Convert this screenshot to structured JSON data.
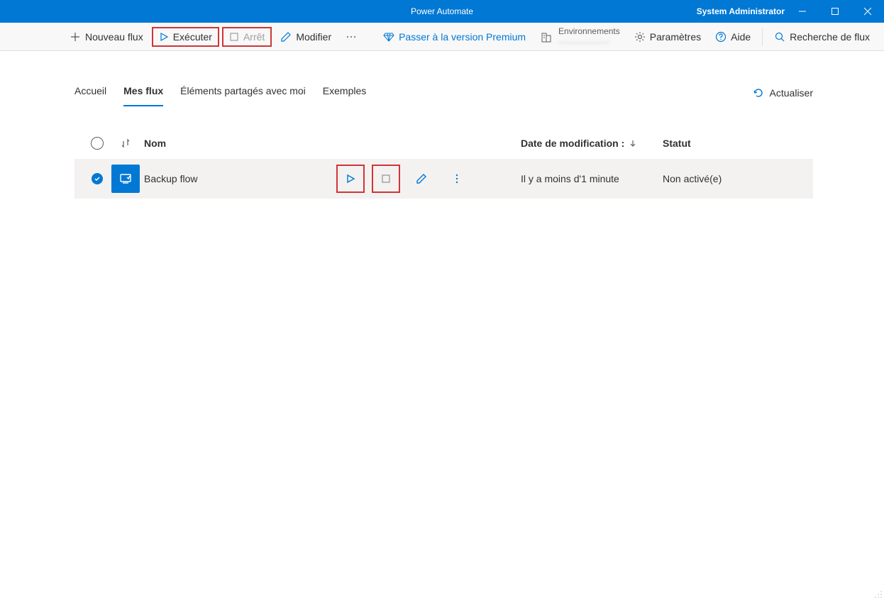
{
  "titleBar": {
    "appTitle": "Power Automate",
    "user": "System Administrator"
  },
  "toolbar": {
    "newFlow": "Nouveau flux",
    "execute": "Exécuter",
    "stop": "Arrêt",
    "modify": "Modifier",
    "premium": "Passer à la version Premium",
    "envLabel": "Environnements",
    "envValue": "——————",
    "settings": "Paramètres",
    "help": "Aide",
    "search": "Recherche de flux"
  },
  "tabs": {
    "home": "Accueil",
    "myFlows": "Mes flux",
    "shared": "Éléments partagés avec moi",
    "examples": "Exemples"
  },
  "refresh": "Actualiser",
  "columns": {
    "name": "Nom",
    "modified": "Date de modification :",
    "status": "Statut"
  },
  "rows": [
    {
      "name": "Backup flow",
      "modified": "Il y a moins d'1 minute",
      "status": "Non activé(e)"
    }
  ]
}
